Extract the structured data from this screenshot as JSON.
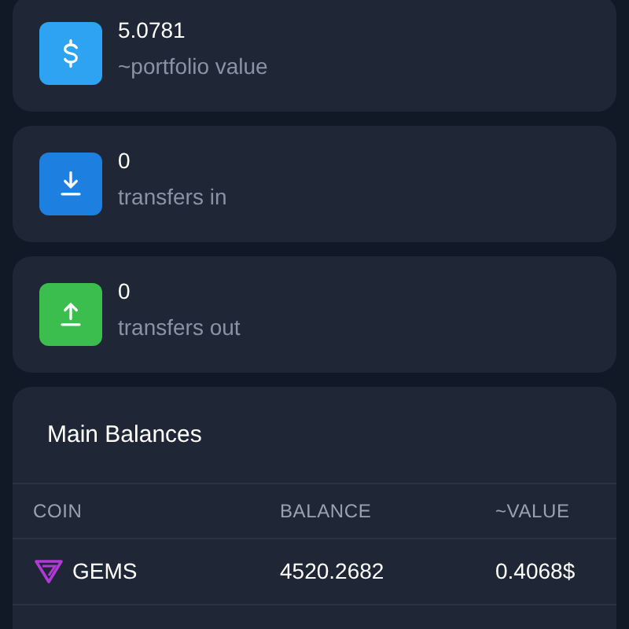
{
  "stats": [
    {
      "kind": "portfolio",
      "value": "5.0781",
      "label": "~portfolio value"
    },
    {
      "kind": "in",
      "value": "0",
      "label": "transfers in"
    },
    {
      "kind": "out",
      "value": "0",
      "label": "transfers out"
    }
  ],
  "balances": {
    "title": "Main Balances",
    "columns": [
      "COIN",
      "BALANCE",
      "~VALUE"
    ],
    "rows": [
      {
        "coin": "GEMS",
        "balance": "4520.2682",
        "value": "0.4068$"
      }
    ]
  }
}
